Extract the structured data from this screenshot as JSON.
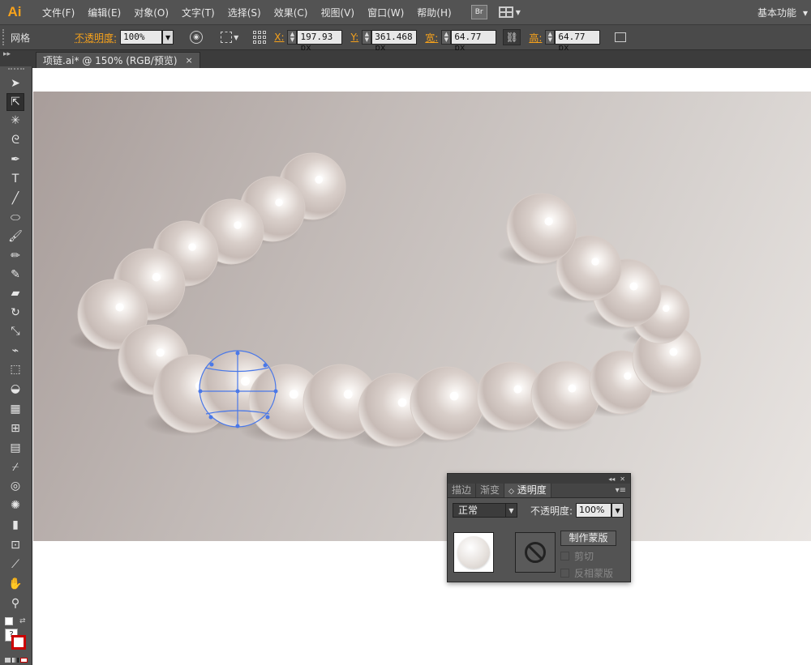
{
  "app": {
    "logo": "Ai"
  },
  "menu": [
    "文件(F)",
    "编辑(E)",
    "对象(O)",
    "文字(T)",
    "选择(S)",
    "效果(C)",
    "视图(V)",
    "窗口(W)",
    "帮助(H)"
  ],
  "bridge_label": "Br",
  "workspace": {
    "label": "基本功能",
    "arrow": "▾"
  },
  "control": {
    "object_type": "网格",
    "opacity_label": "不透明度:",
    "opacity_value": "100%",
    "x_label": "X:",
    "x_value": "197.93 px",
    "y_label": "Y:",
    "y_value": "361.468 px",
    "w_label": "宽:",
    "w_value": "64.77 px",
    "h_label": "高:",
    "h_value": "64.77 px"
  },
  "document_tab": {
    "title": "项链.ai* @ 150% (RGB/预览)",
    "close": "×"
  },
  "tools": [
    {
      "name": "selection-tool-icon",
      "glyph": "➤"
    },
    {
      "name": "direct-selection-tool-icon",
      "glyph": "⇱"
    },
    {
      "name": "magic-wand-tool-icon",
      "glyph": "✳"
    },
    {
      "name": "lasso-tool-icon",
      "glyph": "ᘓ"
    },
    {
      "name": "pen-tool-icon",
      "glyph": "✒"
    },
    {
      "name": "type-tool-icon",
      "glyph": "T"
    },
    {
      "name": "line-tool-icon",
      "glyph": "╱"
    },
    {
      "name": "ellipse-tool-icon",
      "glyph": "⬭"
    },
    {
      "name": "paintbrush-tool-icon",
      "glyph": "🖌"
    },
    {
      "name": "pencil-tool-icon",
      "glyph": "✏"
    },
    {
      "name": "blob-brush-tool-icon",
      "glyph": "✎"
    },
    {
      "name": "eraser-tool-icon",
      "glyph": "▰"
    },
    {
      "name": "rotate-tool-icon",
      "glyph": "↻"
    },
    {
      "name": "scale-tool-icon",
      "glyph": "⤡"
    },
    {
      "name": "warp-tool-icon",
      "glyph": "⌁"
    },
    {
      "name": "free-transform-tool-icon",
      "glyph": "⬚"
    },
    {
      "name": "shape-builder-tool-icon",
      "glyph": "◒"
    },
    {
      "name": "perspective-grid-tool-icon",
      "glyph": "▦"
    },
    {
      "name": "mesh-tool-icon",
      "glyph": "⊞"
    },
    {
      "name": "gradient-tool-icon",
      "glyph": "▤"
    },
    {
      "name": "eyedropper-tool-icon",
      "glyph": "⌿"
    },
    {
      "name": "blend-tool-icon",
      "glyph": "◎"
    },
    {
      "name": "symbol-sprayer-tool-icon",
      "glyph": "✺"
    },
    {
      "name": "column-graph-tool-icon",
      "glyph": "▮"
    },
    {
      "name": "artboard-tool-icon",
      "glyph": "⊡"
    },
    {
      "name": "slice-tool-icon",
      "glyph": "⟋"
    },
    {
      "name": "hand-tool-icon",
      "glyph": "✋"
    },
    {
      "name": "zoom-tool-icon",
      "glyph": "⚲"
    }
  ],
  "transparency_panel": {
    "tabs": [
      "描边",
      "渐变",
      "透明度"
    ],
    "blend_mode": "正常",
    "opacity_label": "不透明度:",
    "opacity_value": "100%",
    "make_mask_label": "制作蒙版",
    "clip_label": "剪切",
    "invert_mask_label": "反相蒙版"
  }
}
